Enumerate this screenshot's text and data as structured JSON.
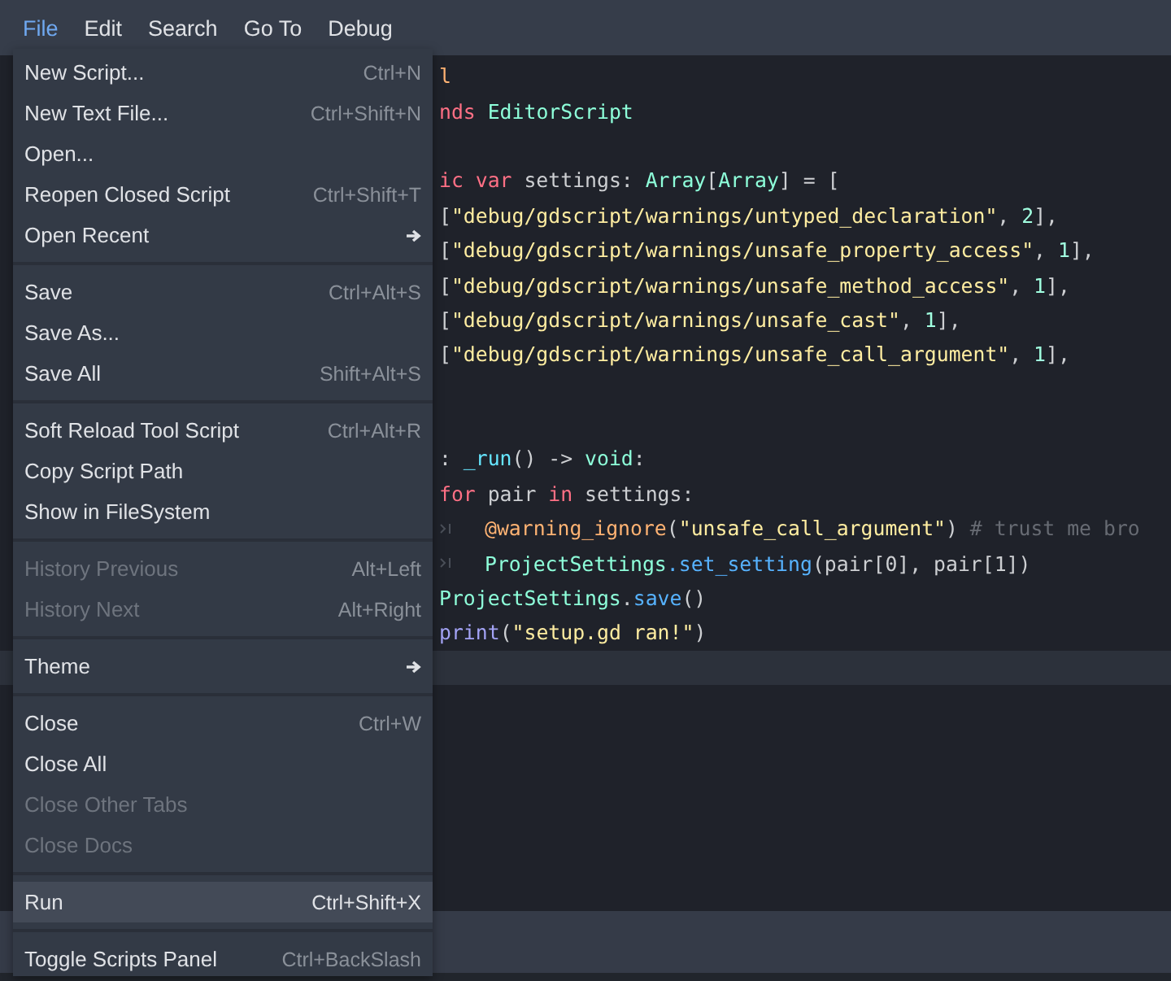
{
  "menu_bar": [
    {
      "label": "File",
      "selected": true
    },
    {
      "label": "Edit",
      "selected": false
    },
    {
      "label": "Search",
      "selected": false
    },
    {
      "label": "Go To",
      "selected": false
    },
    {
      "label": "Debug",
      "selected": false
    }
  ],
  "editor": {
    "lines": [
      {
        "current": false,
        "segments": [
          {
            "kind": "annotation",
            "text": "l"
          }
        ]
      },
      {
        "current": false,
        "segments": [
          {
            "kind": "keyword",
            "text": "nds"
          },
          {
            "kind": "type",
            "text": " EditorScript"
          }
        ]
      },
      {
        "current": false
      },
      {
        "current": false,
        "segments": [
          {
            "kind": "keyword",
            "text": "ic var"
          },
          {
            "kind": "plain",
            "text": " settings: "
          },
          {
            "kind": "type",
            "text": "Array"
          },
          {
            "kind": "plain",
            "text": "["
          },
          {
            "kind": "type",
            "text": "Array"
          },
          {
            "kind": "plain",
            "text": "] = ["
          }
        ]
      },
      {
        "current": false,
        "segments": [
          {
            "kind": "plain",
            "text": "["
          },
          {
            "kind": "string",
            "text": "\"debug/gdscript/warnings/untyped_declaration\""
          },
          {
            "kind": "plain",
            "text": ", "
          },
          {
            "kind": "number",
            "text": "2"
          },
          {
            "kind": "plain",
            "text": "],"
          }
        ]
      },
      {
        "current": false,
        "segments": [
          {
            "kind": "plain",
            "text": "["
          },
          {
            "kind": "string",
            "text": "\"debug/gdscript/warnings/unsafe_property_access\""
          },
          {
            "kind": "plain",
            "text": ", "
          },
          {
            "kind": "number",
            "text": "1"
          },
          {
            "kind": "plain",
            "text": "],"
          }
        ]
      },
      {
        "current": false,
        "segments": [
          {
            "kind": "plain",
            "text": "["
          },
          {
            "kind": "string",
            "text": "\"debug/gdscript/warnings/unsafe_method_access\""
          },
          {
            "kind": "plain",
            "text": ", "
          },
          {
            "kind": "number",
            "text": "1"
          },
          {
            "kind": "plain",
            "text": "],"
          }
        ]
      },
      {
        "current": false,
        "segments": [
          {
            "kind": "plain",
            "text": "["
          },
          {
            "kind": "string",
            "text": "\"debug/gdscript/warnings/unsafe_cast\""
          },
          {
            "kind": "plain",
            "text": ", "
          },
          {
            "kind": "number",
            "text": "1"
          },
          {
            "kind": "plain",
            "text": "],"
          }
        ]
      },
      {
        "current": false,
        "segments": [
          {
            "kind": "plain",
            "text": "["
          },
          {
            "kind": "string",
            "text": "\"debug/gdscript/warnings/unsafe_call_argument\""
          },
          {
            "kind": "plain",
            "text": ", "
          },
          {
            "kind": "number",
            "text": "1"
          },
          {
            "kind": "plain",
            "text": "],"
          }
        ]
      },
      {
        "current": false
      },
      {
        "current": false
      },
      {
        "current": false,
        "segments": [
          {
            "kind": "plain",
            "text": ": "
          },
          {
            "kind": "function",
            "text": "_run"
          },
          {
            "kind": "plain",
            "text": "() -> "
          },
          {
            "kind": "type",
            "text": "void"
          },
          {
            "kind": "plain",
            "text": ":"
          }
        ]
      },
      {
        "current": false,
        "segments": [
          {
            "kind": "keyword",
            "text": "for"
          },
          {
            "kind": "plain",
            "text": " pair "
          },
          {
            "kind": "keyword",
            "text": "in"
          },
          {
            "kind": "plain",
            "text": " settings:"
          }
        ]
      },
      {
        "current": false,
        "segments": [
          {
            "kind": "tab"
          },
          {
            "kind": "annotation",
            "text": "@warning_ignore"
          },
          {
            "kind": "plain",
            "text": "("
          },
          {
            "kind": "string",
            "text": "\"unsafe_call_argument\""
          },
          {
            "kind": "plain",
            "text": ") "
          },
          {
            "kind": "comment",
            "text": "# trust me bro"
          }
        ]
      },
      {
        "current": false,
        "segments": [
          {
            "kind": "tab"
          },
          {
            "kind": "type",
            "text": "ProjectSettings"
          },
          {
            "kind": "method",
            "text": ".set_setting"
          },
          {
            "kind": "plain",
            "text": "(pair[0], pair[1])"
          }
        ]
      },
      {
        "current": false,
        "segments": [
          {
            "kind": "type",
            "text": "ProjectSettings"
          },
          {
            "kind": "plain",
            "text": "."
          },
          {
            "kind": "method",
            "text": "save"
          },
          {
            "kind": "plain",
            "text": "()"
          }
        ]
      },
      {
        "current": false,
        "segments": [
          {
            "kind": "builtin",
            "text": "print"
          },
          {
            "kind": "plain",
            "text": "("
          },
          {
            "kind": "string",
            "text": "\"setup.gd ran!\""
          },
          {
            "kind": "plain",
            "text": ")"
          }
        ]
      },
      {
        "current": true
      }
    ]
  },
  "file_menu": [
    {
      "kind": "item",
      "label": "New Script...",
      "shortcut": "Ctrl+N",
      "disabled": false,
      "selected": false
    },
    {
      "kind": "item",
      "label": "New Text File...",
      "shortcut": "Ctrl+Shift+N",
      "disabled": false,
      "selected": false
    },
    {
      "kind": "item",
      "label": "Open...",
      "disabled": false,
      "selected": false
    },
    {
      "kind": "item",
      "label": "Reopen Closed Script",
      "shortcut": "Ctrl+Shift+T",
      "disabled": false,
      "selected": false
    },
    {
      "kind": "submenu",
      "label": "Open Recent",
      "disabled": false,
      "selected": false
    },
    {
      "kind": "separator"
    },
    {
      "kind": "item",
      "label": "Save",
      "shortcut": "Ctrl+Alt+S",
      "disabled": false,
      "selected": false
    },
    {
      "kind": "item",
      "label": "Save As...",
      "disabled": false,
      "selected": false
    },
    {
      "kind": "item",
      "label": "Save All",
      "shortcut": "Shift+Alt+S",
      "disabled": false,
      "selected": false
    },
    {
      "kind": "separator"
    },
    {
      "kind": "item",
      "label": "Soft Reload Tool Script",
      "shortcut": "Ctrl+Alt+R",
      "disabled": false,
      "selected": false
    },
    {
      "kind": "item",
      "label": "Copy Script Path",
      "disabled": false,
      "selected": false
    },
    {
      "kind": "item",
      "label": "Show in FileSystem",
      "disabled": false,
      "selected": false
    },
    {
      "kind": "separator"
    },
    {
      "kind": "item",
      "label": "History Previous",
      "shortcut": "Alt+Left",
      "disabled": true,
      "selected": false
    },
    {
      "kind": "item",
      "label": "History Next",
      "shortcut": "Alt+Right",
      "disabled": true,
      "selected": false
    },
    {
      "kind": "separator"
    },
    {
      "kind": "submenu",
      "label": "Theme",
      "disabled": false,
      "selected": false
    },
    {
      "kind": "separator"
    },
    {
      "kind": "item",
      "label": "Close",
      "shortcut": "Ctrl+W",
      "disabled": false,
      "selected": false
    },
    {
      "kind": "item",
      "label": "Close All",
      "disabled": false,
      "selected": false
    },
    {
      "kind": "item",
      "label": "Close Other Tabs",
      "disabled": true,
      "selected": false
    },
    {
      "kind": "item",
      "label": "Close Docs",
      "disabled": true,
      "selected": false
    },
    {
      "kind": "separator"
    },
    {
      "kind": "item",
      "label": "Run",
      "shortcut": "Ctrl+Shift+X",
      "disabled": false,
      "selected": true
    },
    {
      "kind": "separator"
    },
    {
      "kind": "item",
      "label": "Toggle Scripts Panel",
      "shortcut": "Ctrl+BackSlash",
      "disabled": false,
      "selected": false
    }
  ]
}
